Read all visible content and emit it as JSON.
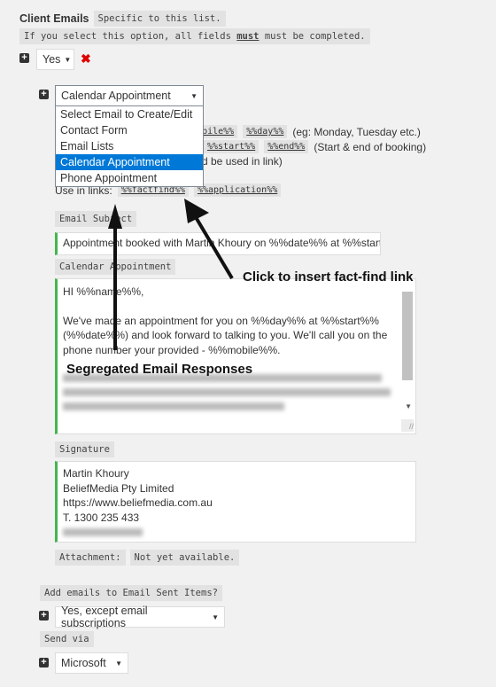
{
  "header": {
    "title": "Client Emails",
    "subtitle": "Specific to this list.",
    "notice_pre": "If you select this option, all fields ",
    "notice_em": "must",
    "notice_post": " must be completed."
  },
  "enable_select": {
    "value": "Yes"
  },
  "email_select": {
    "value": "Calendar Appointment",
    "options": [
      "Select Email to Create/Edit",
      "Contact Form",
      "Email Lists",
      "Calendar Appointment",
      "Phone Appointment"
    ],
    "selected_index": 3
  },
  "shortcodes": {
    "line1_tags": [
      "%%mobile%%",
      "%%day%%"
    ],
    "line1_note": "(eg: Monday, Tuesday etc.)",
    "line2_tags": [
      "%%start%%",
      "%%end%%"
    ],
    "line2_note": "(Start & end of booking)",
    "line3_note": "d be used in link)",
    "links_label": "Use in links:",
    "link_tags": [
      "%%factfind%%",
      "%%application%%"
    ]
  },
  "subject": {
    "label": "Email Subject",
    "value": "Appointment booked with Martin Khoury on %%date%% at %%start%%"
  },
  "body": {
    "label": "Calendar Appointment",
    "line1": "HI %%name%%,",
    "para": "We've made an appointment for you on %%day%% at %%start%% (%%date%%) and look forward to talking to you. We'll call you on the phone number your provided - %%mobile%%."
  },
  "signature": {
    "label": "Signature",
    "lines": [
      "Martin Khoury",
      "BeliefMedia Pty Limited",
      "https://www.beliefmedia.com.au",
      "T. 1300 235 433"
    ]
  },
  "attachment": {
    "label": "Attachment:",
    "value": "Not yet available."
  },
  "sent_items": {
    "label": "Add emails to Email Sent Items?",
    "value": "Yes, except email subscriptions"
  },
  "send_via": {
    "label": "Send via",
    "value": "Microsoft"
  },
  "annotations": {
    "factfind": "Click to insert fact-find link",
    "segregated": "Segregated Email Responses"
  },
  "colors": {
    "accent_green": "#46b450",
    "highlight": "#0078d7",
    "remove_red": "#e00000"
  }
}
